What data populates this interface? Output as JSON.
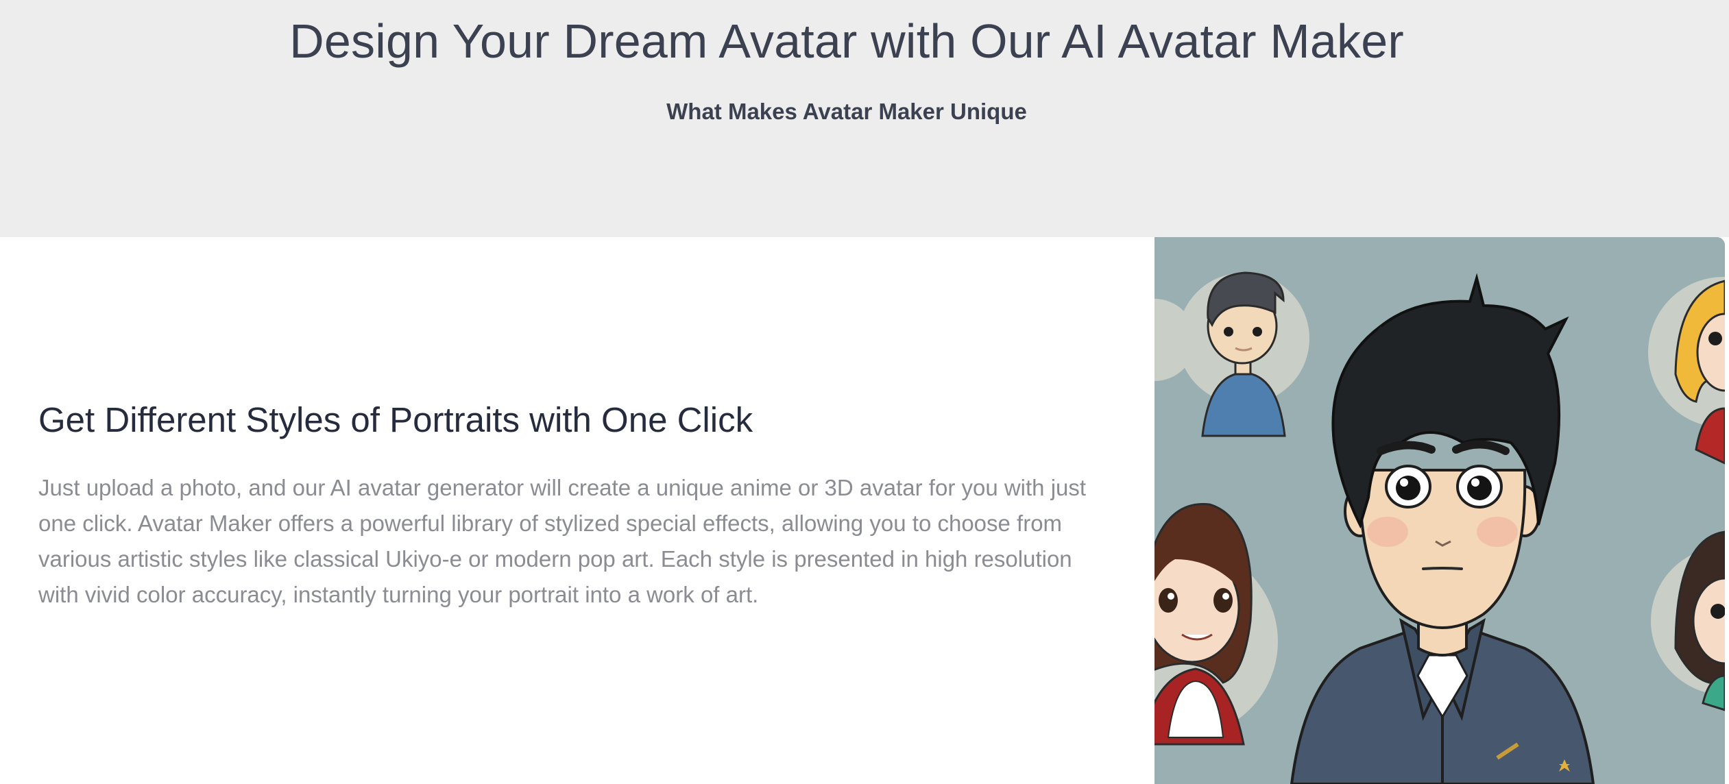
{
  "hero": {
    "title": "Design Your Dream Avatar with Our AI Avatar Maker",
    "subtitle": "What Makes Avatar Maker Unique"
  },
  "feature": {
    "title": "Get Different Styles of Portraits with One Click",
    "body": "Just upload a photo, and our AI avatar generator will create a unique anime or 3D avatar for you with just one click. Avatar Maker offers a powerful library of stylized special effects, allowing you to choose from various artistic styles like classical Ukiyo-e or modern pop art. Each style is presented in high resolution with vivid color accuracy, instantly turning your portrait into a work of art."
  },
  "colors": {
    "hero_bg": "#ededed",
    "title_text": "#3b4150",
    "body_text": "#8a8c92",
    "art_bg": "#9aafb1"
  }
}
